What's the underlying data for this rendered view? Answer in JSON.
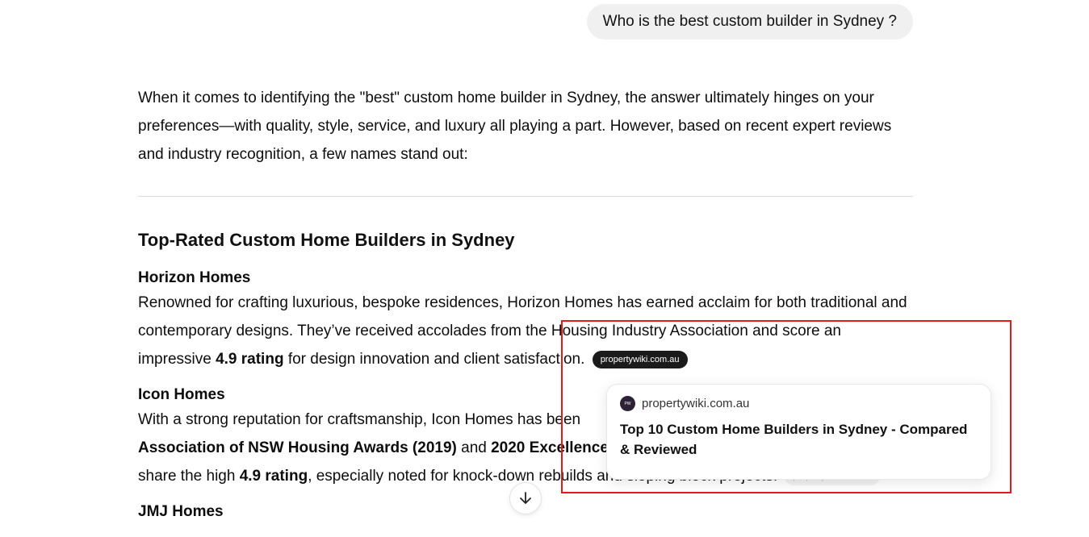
{
  "user_message": "Who is the best custom builder in Sydney ?",
  "answer": {
    "intro": "When it comes to identifying the \"best\" custom home builder in Sydney, the answer ultimately hinges on your preferences—with quality, style, service, and luxury all playing a part. However, based on recent expert reviews and industry recognition, a few names stand out:",
    "section_heading": "Top-Rated Custom Home Builders in Sydney",
    "builders": [
      {
        "name": "Horizon Homes",
        "desc_1": "Renowned for crafting luxurious, bespoke residences, Horizon Homes has earned acclaim for both traditional and contemporary designs. They’ve received accolades from the Housing Industry Association and score an impressive ",
        "desc_bold_1": "4.9 rating",
        "desc_2": " for design innovation and client satisfaction.",
        "citation": "propertywiki.com.au"
      },
      {
        "name": "Icon Homes",
        "desc_1": "With a strong reputation for craftsmanship, Icon Homes has been",
        "desc_bold_1": "Association of NSW Housing Awards (2019)",
        "desc_2": " and ",
        "desc_bold_2": "2020 Excellence",
        "desc_3": "share the high ",
        "desc_bold_3": "4.9 rating",
        "desc_4": ", especially noted for knock-down rebuilds and sloping block projects.",
        "citation": "propertywiki.com.au"
      },
      {
        "name": "JMJ Homes"
      }
    ]
  },
  "citation_popup": {
    "source": "propertywiki.com.au",
    "favicon_text": "PW",
    "title": "Top 10 Custom Home Builders in Sydney - Compared & Reviewed"
  },
  "colors": {
    "highlight_border": "#e01b1b",
    "chip_bg": "#1b1b1b",
    "bubble_bg": "#f0f0f0"
  },
  "icons": {
    "scroll_down": "arrow-down-icon"
  }
}
